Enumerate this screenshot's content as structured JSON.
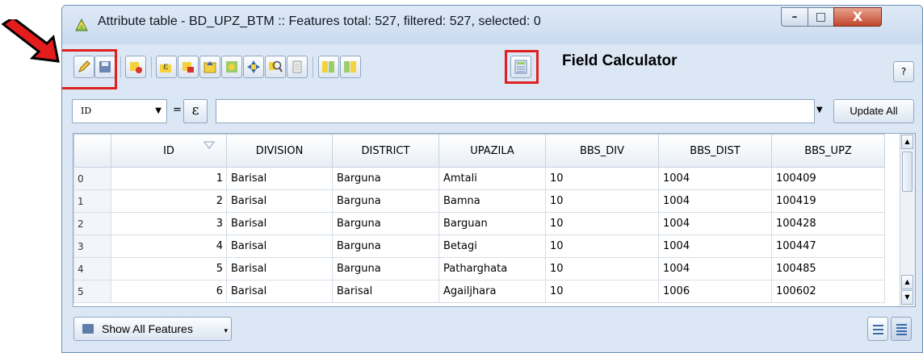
{
  "window": {
    "title": "Attribute table - BD_UPZ_BTM :: Features total: 527, filtered: 527, selected: 0",
    "minimize_glyph": "–",
    "maximize_glyph": "□",
    "close_glyph": "X"
  },
  "toolbar": {
    "annotation_label": "Field Calculator",
    "help_label": "?",
    "buttons": [
      "toggle-editing-icon",
      "save-edits-icon",
      "delete-selected-icon",
      "select-by-expression-icon",
      "deselect-all-icon",
      "move-selection-top-icon",
      "invert-selection-icon",
      "pan-to-selected-icon",
      "zoom-to-selected-icon",
      "copy-rows-icon",
      "new-column-icon",
      "delete-column-icon",
      "field-calculator-icon"
    ]
  },
  "filter": {
    "field_value": "ID",
    "equals": "=",
    "expression_symbol": "ε",
    "update_all_label": "Update All"
  },
  "table": {
    "columns": [
      "ID",
      "DIVISION",
      "DISTRICT",
      "UPAZILA",
      "BBS_DIV",
      "BBS_DIST",
      "BBS_UPZ"
    ],
    "rows": [
      {
        "index": "0",
        "cells": [
          "1",
          "Barisal",
          "Barguna",
          "Amtali",
          "10",
          "1004",
          "100409"
        ]
      },
      {
        "index": "1",
        "cells": [
          "2",
          "Barisal",
          "Barguna",
          "Bamna",
          "10",
          "1004",
          "100419"
        ]
      },
      {
        "index": "2",
        "cells": [
          "3",
          "Barisal",
          "Barguna",
          "Barguan",
          "10",
          "1004",
          "100428"
        ]
      },
      {
        "index": "3",
        "cells": [
          "4",
          "Barisal",
          "Barguna",
          "Betagi",
          "10",
          "1004",
          "100447"
        ]
      },
      {
        "index": "4",
        "cells": [
          "5",
          "Barisal",
          "Barguna",
          "Patharghata",
          "10",
          "1004",
          "100485"
        ]
      },
      {
        "index": "5",
        "cells": [
          "6",
          "Barisal",
          "Barisal",
          "Agailjhara",
          "10",
          "1006",
          "100602"
        ]
      }
    ]
  },
  "bottom": {
    "show_features_label": "Show All Features",
    "caret": "▾"
  },
  "colors": {
    "highlight": "#e02020",
    "arrow": "#e02020"
  }
}
